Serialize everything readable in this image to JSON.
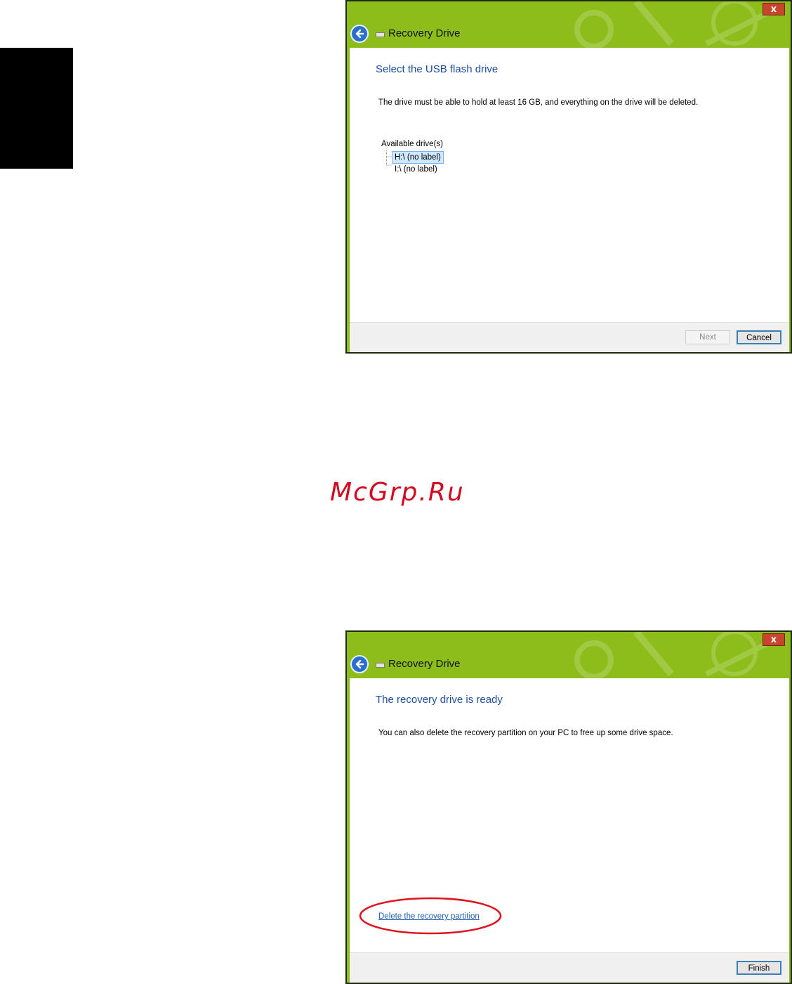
{
  "watermark": "McGrp.Ru",
  "window1": {
    "title": "Recovery Drive",
    "close_glyph": "x",
    "heading": "Select the USB flash drive",
    "description": "The drive must be able to hold at least 16 GB, and everything on the drive will be deleted.",
    "tree_label": "Available drive(s)",
    "drives": [
      "H:\\ (no label)",
      "I:\\ (no label)"
    ],
    "selected_drive": "H:\\ (no label)",
    "buttons": {
      "next": "Next",
      "cancel": "Cancel"
    },
    "next_enabled": false
  },
  "window2": {
    "title": "Recovery Drive",
    "close_glyph": "x",
    "heading": "The recovery drive is ready",
    "description": "You can also delete the recovery partition on your PC to free up some drive space.",
    "link": "Delete the recovery partition",
    "buttons": {
      "finish": "Finish"
    }
  },
  "colors": {
    "titlebar": "#8cbd1a",
    "heading": "#1f4e9f",
    "highlight_circle": "#e0121e",
    "link": "#1f62b0"
  },
  "icons": [
    "back-arrow-icon",
    "drive-icon",
    "close-icon"
  ]
}
